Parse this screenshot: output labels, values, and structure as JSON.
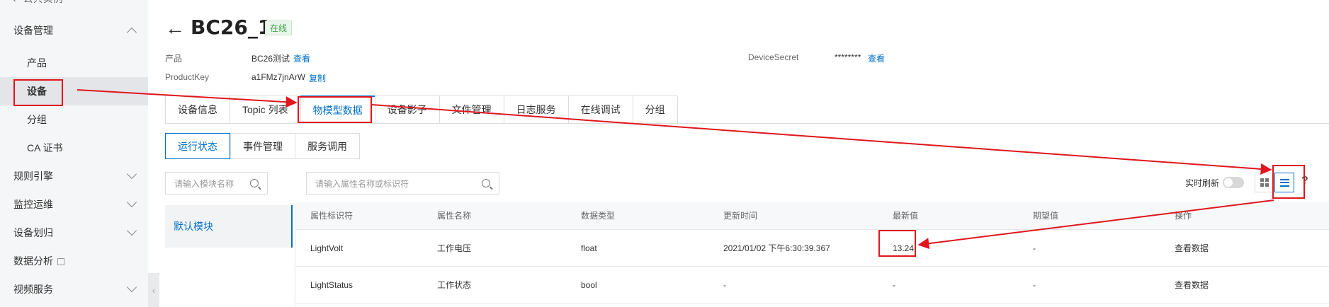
{
  "sidebar": {
    "top_link": "公共实例",
    "groups": [
      {
        "label": "设备管理"
      },
      {
        "label": "规则引擎"
      },
      {
        "label": "监控运维"
      },
      {
        "label": "设备划归"
      },
      {
        "label": "数据分析"
      },
      {
        "label": "视频服务"
      }
    ],
    "items": [
      {
        "label": "产品"
      },
      {
        "label": "设备"
      },
      {
        "label": "分组"
      },
      {
        "label": "CA 证书"
      }
    ]
  },
  "header": {
    "title": "BC26_1",
    "status": "在线",
    "product_label": "产品",
    "product_value": "BC26测试",
    "product_link": "查看",
    "productkey_label": "ProductKey",
    "productkey_value": "a1FMz7jnArW",
    "productkey_link": "复制",
    "devicesecret_label": "DeviceSecret",
    "devicesecret_value": "********",
    "devicesecret_link": "查看"
  },
  "tabs": [
    "设备信息",
    "Topic 列表",
    "物模型数据",
    "设备影子",
    "文件管理",
    "日志服务",
    "在线调试",
    "分组"
  ],
  "subtabs": [
    "运行状态",
    "事件管理",
    "服务调用"
  ],
  "module_search": {
    "placeholder": "请输入模块名称"
  },
  "prop_search": {
    "placeholder": "请输入属性名称或标识符"
  },
  "module": {
    "label": "默认模块"
  },
  "toolbar": {
    "realtime_label": "实时刷新",
    "help": "?"
  },
  "table": {
    "headers": [
      "属性标识符",
      "属性名称",
      "数据类型",
      "更新时间",
      "最新值",
      "期望值",
      "操作"
    ],
    "rows": [
      [
        "LightVolt",
        "工作电压",
        "float",
        "2021/01/02 下午6:30:39.367",
        "13.24",
        "-",
        "查看数据"
      ],
      [
        "LightStatus",
        "工作状态",
        "bool",
        "-",
        "-",
        "-",
        "查看数据"
      ]
    ]
  },
  "colors": {
    "accent": "#0070cc",
    "annotation": "#e0161c",
    "online": "#3fa34d"
  }
}
